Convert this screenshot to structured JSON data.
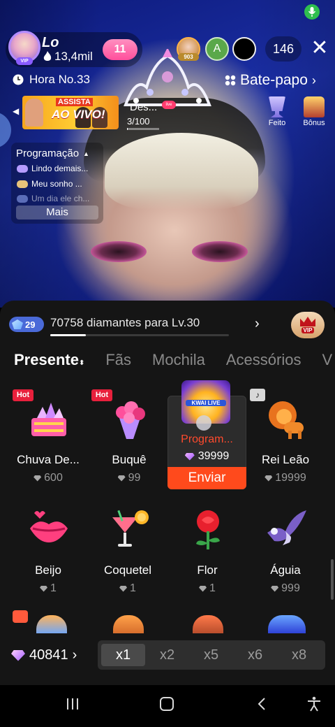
{
  "status": {
    "mic_icon": "mic-icon",
    "mic_color": "#2fbf4f"
  },
  "host": {
    "name": "Lo",
    "likes": "13,4mil",
    "level": "11",
    "vip": "VIP"
  },
  "viewers": {
    "top_badge": "903",
    "avatar2_letter": "A",
    "count": "146"
  },
  "hour_rank": {
    "label": "Hora No.33"
  },
  "chat": {
    "label": "Bate-papo"
  },
  "banner": {
    "line1": "ASSISTA",
    "line2": "AO VIVO!"
  },
  "task": {
    "title": "Des...",
    "progress": "3/100",
    "progress_fraction": 0.03
  },
  "side_actions": {
    "done_label": "Feito",
    "bonus_label": "Bônus"
  },
  "programacao": {
    "title": "Programação",
    "items": [
      "Lindo demais...",
      "Meu sonho ...",
      "Um dia ele ch..."
    ],
    "more_label": "Mais"
  },
  "level_bar": {
    "badge": "29",
    "text": "70758 diamantes para Lv.30",
    "progress_fraction": 0.2,
    "vip_label": "VIP"
  },
  "tabs": [
    {
      "label": "Presente",
      "active": true
    },
    {
      "label": "Fãs",
      "active": false
    },
    {
      "label": "Mochila",
      "active": false
    },
    {
      "label": "Acessórios",
      "active": false
    },
    {
      "label": "V",
      "active": false
    }
  ],
  "gifts": [
    {
      "name": "Chuva De...",
      "price": "600",
      "hot": "Hot"
    },
    {
      "name": "Buquê",
      "price": "99",
      "hot": "Hot"
    },
    {
      "name": "Program...",
      "price": "39999",
      "selected": true,
      "image_text": "KWAI LIVE"
    },
    {
      "name": "Rei Leão",
      "price": "19999",
      "music_tag": "♪"
    },
    {
      "name": "Beijo",
      "price": "1"
    },
    {
      "name": "Coquetel",
      "price": "1"
    },
    {
      "name": "Flor",
      "price": "1"
    },
    {
      "name": "Águia",
      "price": "999"
    }
  ],
  "send_label": "Enviar",
  "balance": {
    "value": "40841"
  },
  "multipliers": [
    {
      "label": "x1",
      "active": true
    },
    {
      "label": "x2",
      "active": false
    },
    {
      "label": "x5",
      "active": false
    },
    {
      "label": "x6",
      "active": false
    },
    {
      "label": "x8",
      "active": false
    }
  ],
  "colors": {
    "accent": "#ff4a1c",
    "hot": "#e8203c",
    "panel": "#151515",
    "level_pill": "#ff4f9c"
  }
}
